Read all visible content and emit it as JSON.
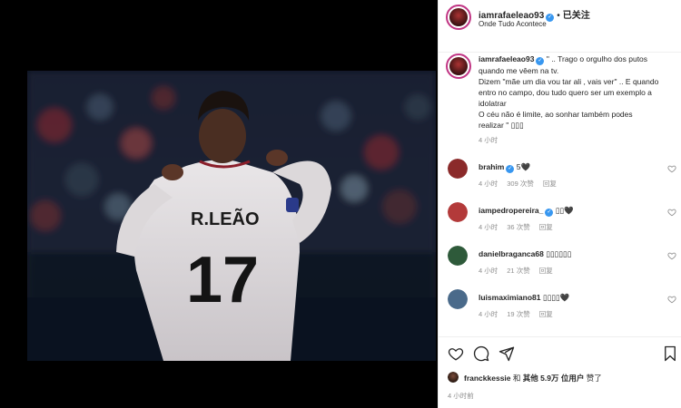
{
  "header": {
    "username": "iamrafaeleao93",
    "verified_mark": "✓",
    "dot": "•",
    "follow_label": "已关注",
    "location": "Onde Tudo Acontece"
  },
  "photo": {
    "jersey_name": "R.LEÃO",
    "jersey_number": "17"
  },
  "caption": {
    "username": "iamrafaeleao93",
    "lines": [
      "\" .. Trago o orgulho dos putos",
      "quando me vêem na tv.",
      "Dizem \"mãe um dia vou tar ali , vais ver\" .. E quando",
      "entro no campo, dou tudo quero ser um exemplo a",
      "idolatrar",
      "O céu não é limite, ao sonhar também podes",
      "realizar \" ▯▯▯"
    ],
    "time": "4 小时"
  },
  "comments": [
    {
      "username": "brahim",
      "text": "5🖤",
      "time": "4 小时",
      "likes": "309 次赞",
      "reply": "回复",
      "avatar_color": "#8b2a2a"
    },
    {
      "username": "iampedropereira_",
      "text": "▯▯🖤",
      "time": "4 小时",
      "likes": "36 次赞",
      "reply": "回复",
      "avatar_color": "#b33a3a"
    },
    {
      "username": "danielbraganca68",
      "text": "▯▯▯▯▯▯",
      "time": "4 小时",
      "likes": "21 次赞",
      "reply": "回复",
      "avatar_color": "#2e5a3a"
    },
    {
      "username": "luismaximiano81",
      "text": "▯▯▯▯🖤",
      "time": "4 小时",
      "likes": "19 次赞",
      "reply": "回复",
      "avatar_color": "#4a6a8a"
    }
  ],
  "likes": {
    "first_user": "franckkessie",
    "and": "和",
    "others": "其他 5.9万 位用户",
    "liked": "赞了"
  },
  "post_time": "4 小时前",
  "colors": {
    "verified": "#3897f0",
    "meta_gray": "#8e8e8e",
    "text": "#262626",
    "ring": "#c13584"
  },
  "icons": [
    "heart-icon",
    "comment-icon",
    "share-icon",
    "bookmark-icon",
    "small-heart-icon"
  ]
}
